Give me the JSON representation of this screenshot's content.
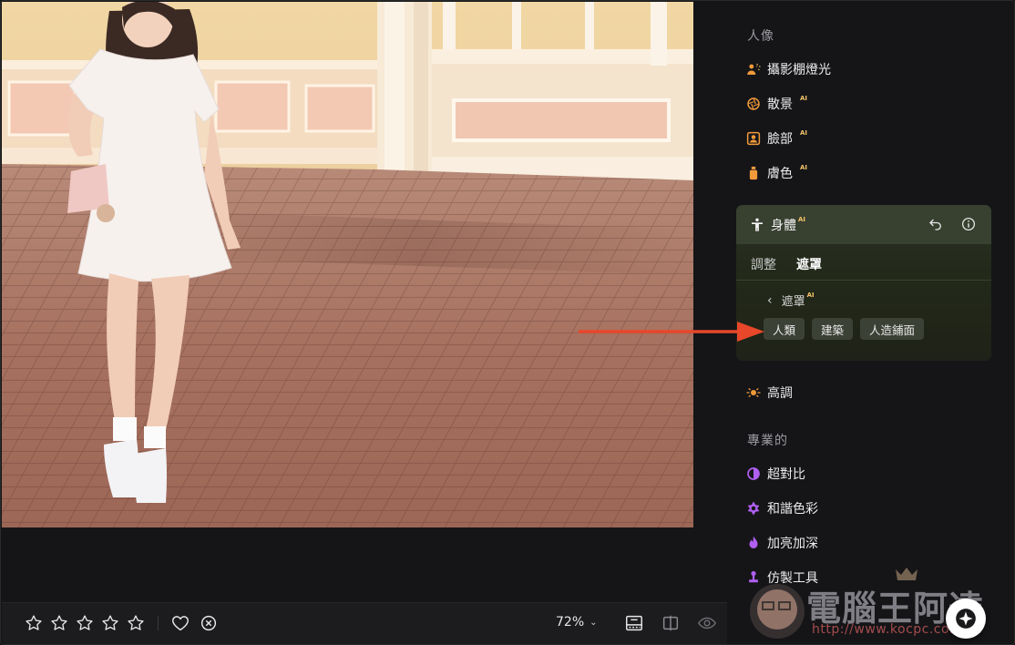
{
  "sidebar": {
    "portrait_section": "人像",
    "portrait_tools": [
      {
        "label": "攝影棚燈光",
        "ai": "",
        "icon": "studio-light-icon"
      },
      {
        "label": "散景",
        "ai": "AI",
        "icon": "bokeh-icon"
      },
      {
        "label": "臉部",
        "ai": "AI",
        "icon": "face-icon"
      },
      {
        "label": "膚色",
        "ai": "AI",
        "icon": "skin-tone-icon"
      }
    ],
    "body_panel": {
      "title": "身體",
      "ai": "AI",
      "tabs": [
        "調整",
        "遮罩"
      ],
      "active_tab": "遮罩",
      "back_label": "遮罩",
      "back_ai": "AI",
      "chips": [
        "人類",
        "建築",
        "人造鋪面"
      ]
    },
    "highlight_tool": {
      "label": "高調",
      "icon": "high-key-icon"
    },
    "pro_section": "專業的",
    "pro_tools": [
      {
        "label": "超對比",
        "icon": "super-contrast-icon"
      },
      {
        "label": "和諧色彩",
        "icon": "color-harmony-icon"
      },
      {
        "label": "加亮加深",
        "icon": "dodge-burn-icon"
      },
      {
        "label": "仿製工具",
        "icon": "clone-icon"
      }
    ]
  },
  "bottom_bar": {
    "rating_stars": 5,
    "rating_value": 0,
    "zoom": "72%"
  },
  "watermark": {
    "text": "電腦王阿達",
    "url": "http://www.kocpc.com.tw"
  },
  "colors": {
    "accent_orange": "#f09a3a",
    "accent_purple": "#a44ee0",
    "ai_badge": "#f3c46a",
    "annotation_arrow": "#e8472a"
  }
}
